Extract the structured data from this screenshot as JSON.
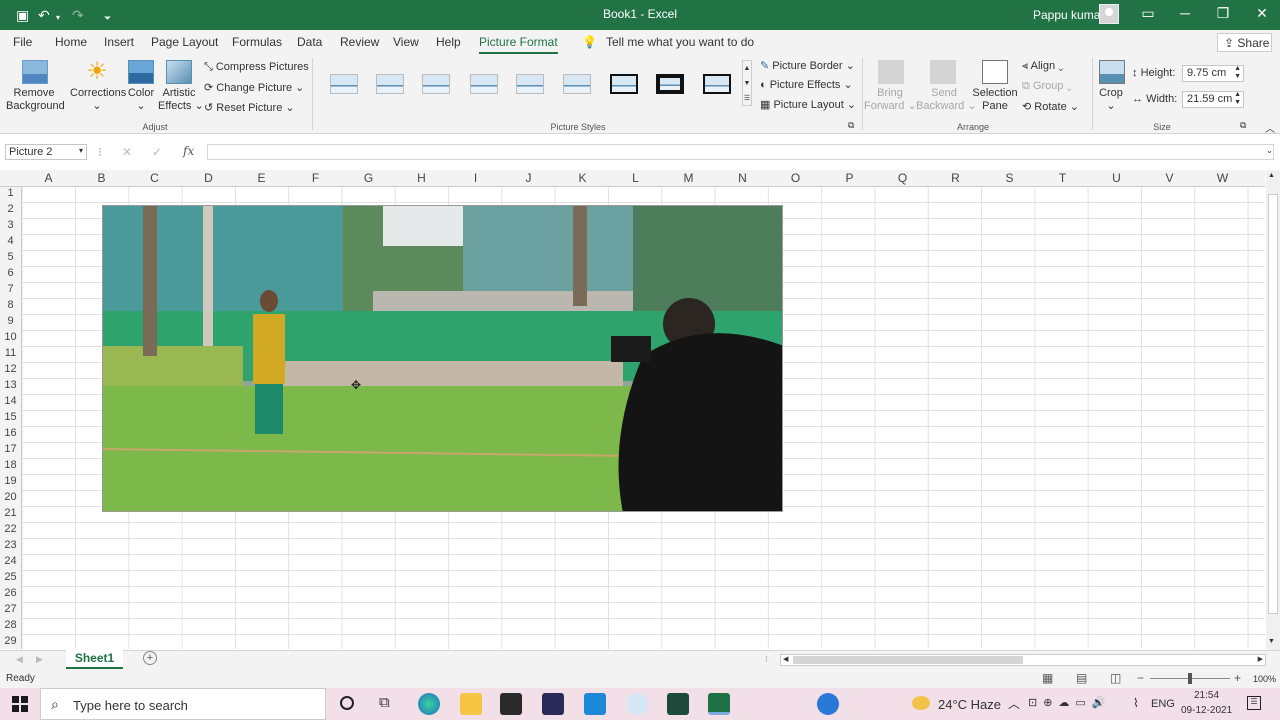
{
  "title_bar": {
    "doc_title": "Book1  -  Excel",
    "user": "Pappu kumar"
  },
  "tabs": [
    {
      "label": "File"
    },
    {
      "label": "Home"
    },
    {
      "label": "Insert"
    },
    {
      "label": "Page Layout"
    },
    {
      "label": "Formulas"
    },
    {
      "label": "Data"
    },
    {
      "label": "Review"
    },
    {
      "label": "View"
    },
    {
      "label": "Help"
    },
    {
      "label": "Picture Format"
    }
  ],
  "tell_me": "Tell me what you want to do",
  "share": "Share",
  "ribbon": {
    "adjust": {
      "remove_bg_1": "Remove",
      "remove_bg_2": "Background",
      "corrections": "Corrections",
      "color": "Color",
      "artistic_1": "Artistic",
      "artistic_2": "Effects",
      "compress": "Compress Pictures",
      "change": "Change Picture",
      "reset": "Reset Picture",
      "group": "Adjust"
    },
    "styles": {
      "group": "Picture Styles"
    },
    "border": "Picture Border",
    "effects": "Picture Effects",
    "layout": "Picture Layout",
    "arrange": {
      "bring_1": "Bring",
      "bring_2": "Forward",
      "send_1": "Send",
      "send_2": "Backward",
      "selection_1": "Selection",
      "selection_2": "Pane",
      "align": "Align",
      "group_btn": "Group",
      "rotate": "Rotate",
      "group": "Arrange"
    },
    "size": {
      "crop": "Crop",
      "height_label": "Height:",
      "height": "9.75 cm",
      "width_label": "Width:",
      "width": "21.59 cm",
      "group": "Size"
    }
  },
  "name_box": "Picture 2",
  "columns": [
    "A",
    "B",
    "C",
    "D",
    "E",
    "F",
    "G",
    "H",
    "I",
    "J",
    "K",
    "L",
    "M",
    "N",
    "O",
    "P",
    "Q",
    "R",
    "S",
    "T",
    "U",
    "V",
    "W"
  ],
  "rows": [
    "1",
    "2",
    "3",
    "4",
    "5",
    "6",
    "7",
    "8",
    "9",
    "10",
    "11",
    "12",
    "13",
    "14",
    "15",
    "16",
    "17",
    "18",
    "19",
    "20",
    "21",
    "22",
    "23",
    "24",
    "25",
    "26",
    "27",
    "28",
    "29"
  ],
  "sheet_tab": "Sheet1",
  "status": {
    "ready": "Ready",
    "zoom": "100%"
  },
  "taskbar": {
    "search_placeholder": "Type here to search",
    "weather": "24°C  Haze",
    "lang": "ENG",
    "time": "21:54",
    "date": "09-12-2021"
  },
  "colors": {
    "excel_green": "#217346",
    "taskbar": "#f3dfe7"
  }
}
